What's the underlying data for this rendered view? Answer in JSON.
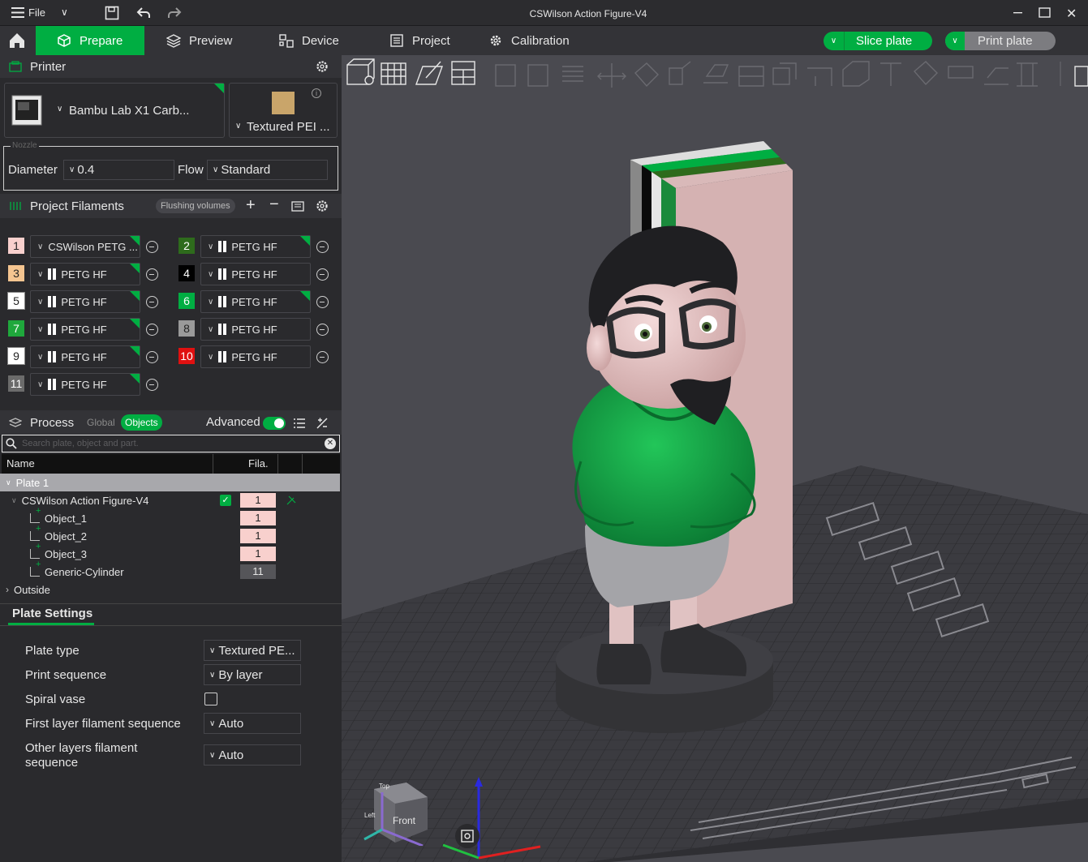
{
  "window": {
    "title": "CSWilson Action Figure-V4",
    "file_menu": "File"
  },
  "tabs": [
    {
      "label": "Prepare"
    },
    {
      "label": "Preview"
    },
    {
      "label": "Device"
    },
    {
      "label": "Project"
    },
    {
      "label": "Calibration"
    }
  ],
  "actions": {
    "slice": "Slice plate",
    "print": "Print plate"
  },
  "printer": {
    "header": "Printer",
    "name": "Bambu Lab X1 Carb...",
    "plate": "Textured PEI ...",
    "nozzle_legend": "Nozzle",
    "diameter_label": "Diameter",
    "diameter_value": "0.4",
    "flow_label": "Flow",
    "flow_value": "Standard"
  },
  "filaments": {
    "header": "Project Filaments",
    "flushing_button": "Flushing volumes",
    "items": [
      {
        "num": "1",
        "name": "CSWilson PETG ...",
        "color": "#f8d0cd",
        "text_color": "#222222"
      },
      {
        "num": "2",
        "name": "PETG HF",
        "color": "#2e6b1c",
        "text_color": "#ffffff"
      },
      {
        "num": "3",
        "name": "PETG HF",
        "color": "#f5c590",
        "text_color": "#222222"
      },
      {
        "num": "4",
        "name": "PETG HF",
        "color": "#000000",
        "text_color": "#ffffff"
      },
      {
        "num": "5",
        "name": "PETG HF",
        "color": "#ffffff",
        "text_color": "#222222"
      },
      {
        "num": "6",
        "name": "PETG HF",
        "color": "#00ae42",
        "text_color": "#ffffff"
      },
      {
        "num": "7",
        "name": "PETG HF",
        "color": "#1fa83c",
        "text_color": "#ffffff"
      },
      {
        "num": "8",
        "name": "PETG HF",
        "color": "#9a9a9a",
        "text_color": "#222222"
      },
      {
        "num": "9",
        "name": "PETG HF",
        "color": "#ffffff",
        "text_color": "#222222"
      },
      {
        "num": "10",
        "name": "PETG HF",
        "color": "#e01010",
        "text_color": "#ffffff"
      },
      {
        "num": "11",
        "name": "PETG HF",
        "color": "#6b6b6b",
        "text_color": "#ffffff"
      }
    ]
  },
  "process": {
    "header": "Process",
    "global": "Global",
    "objects": "Objects",
    "advanced": "Advanced",
    "search_placeholder": "Search plate, object and part.",
    "col_name": "Name",
    "col_fila": "Fila.",
    "plate": "Plate 1",
    "tree": [
      {
        "name": "CSWilson Action Figure-V4",
        "fila": "1"
      },
      {
        "name": "Object_1",
        "fila": "1"
      },
      {
        "name": "Object_2",
        "fila": "1"
      },
      {
        "name": "Object_3",
        "fila": "1"
      },
      {
        "name": "Generic-Cylinder",
        "fila": "11"
      }
    ],
    "outside": "Outside"
  },
  "plate_settings": {
    "tab": "Plate Settings",
    "plate_type_label": "Plate type",
    "plate_type_value": "Textured PE...",
    "print_sequence_label": "Print sequence",
    "print_sequence_value": "By layer",
    "spiral_vase_label": "Spiral vase",
    "first_layer_label": "First layer filament sequence",
    "first_layer_value": "Auto",
    "other_layers_label_1": "Other layers filament",
    "other_layers_label_2": "sequence",
    "other_layers_value": "Auto"
  },
  "viewcube": {
    "front": "Front",
    "top": "Top",
    "left": "Left"
  },
  "colors": {
    "accent": "#00ae42",
    "panel": "#2a2a2d",
    "viewport": "#4a4a50"
  }
}
